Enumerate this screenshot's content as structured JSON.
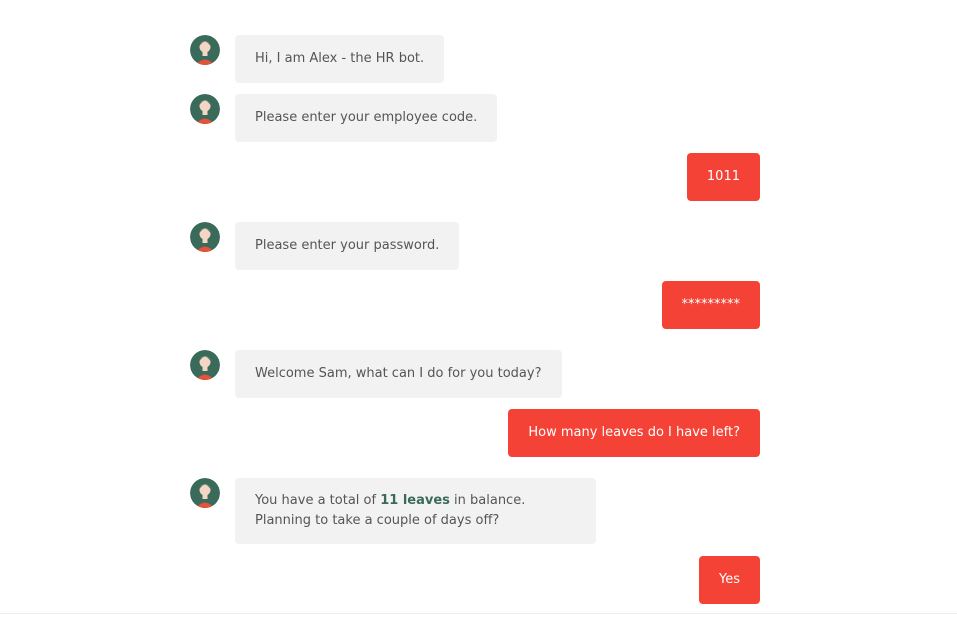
{
  "bot": {
    "name": "Alex",
    "avatar_icon": "bot-avatar-icon"
  },
  "colors": {
    "bot_bubble": "#f2f2f2",
    "user_bubble": "#f44336",
    "avatar_bg": "#3a6b5a",
    "highlight": "#3a6b5a"
  },
  "messages": [
    {
      "from": "bot",
      "text": "Hi, I am Alex - the HR bot."
    },
    {
      "from": "bot",
      "text": "Please enter your employee code."
    },
    {
      "from": "user",
      "text": "1011"
    },
    {
      "from": "bot",
      "text": "Please enter your password."
    },
    {
      "from": "user",
      "text": "*********"
    },
    {
      "from": "bot",
      "text": "Welcome Sam, what can I do for you today?"
    },
    {
      "from": "user",
      "text": "How many leaves do I have left?"
    },
    {
      "from": "bot",
      "text_before": "You have a total of ",
      "highlight": "11 leaves",
      "text_after": " in balance. Planning to take a couple of days off?"
    },
    {
      "from": "user",
      "text": "Yes"
    }
  ]
}
